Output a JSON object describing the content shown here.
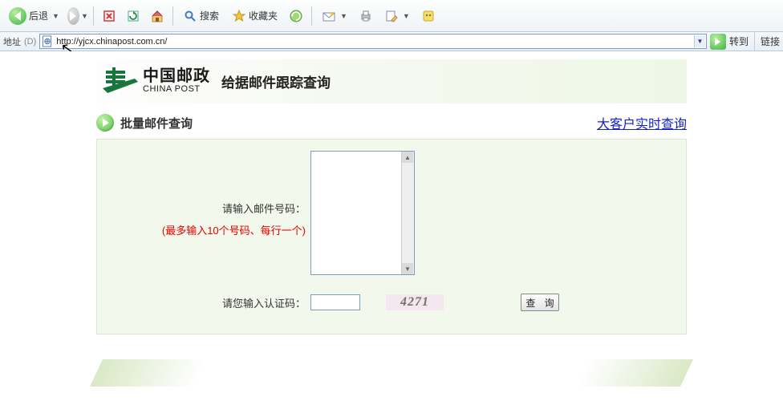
{
  "toolbar": {
    "back_label": "后退",
    "search_label": "搜索",
    "fav_label": "收藏夹"
  },
  "addressbar": {
    "label": "地址",
    "key": "(D)",
    "url": "http://yjcx.chinapost.com.cn/",
    "go_label": "转到",
    "links_label": "链接"
  },
  "header": {
    "logo_cn": "中国邮政",
    "logo_en": "CHINA POST",
    "title": "给据邮件跟踪查询"
  },
  "subbar": {
    "batch_label": "批量邮件查询",
    "bigcust_link": "大客户实时查询"
  },
  "form": {
    "mailnum_label": "请输入邮件号码：",
    "mailnum_hint": "(最多输入10个号码、每行一个)",
    "captcha_label": "请您输入认证码：",
    "captcha_value": "4271",
    "submit_label": "查 询"
  }
}
